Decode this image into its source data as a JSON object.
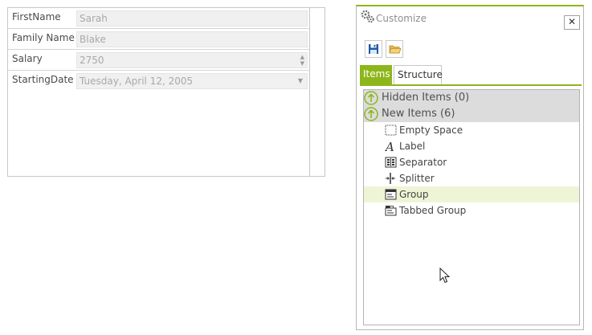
{
  "form": {
    "rows": [
      {
        "label": "FirstName",
        "value": "Sarah",
        "control": "text"
      },
      {
        "label": "Family Name",
        "value": "Blake",
        "control": "text"
      },
      {
        "label": "Salary",
        "value": "2750",
        "control": "spin"
      },
      {
        "label": "StartingDate",
        "value": "Tuesday, April 12, 2005",
        "control": "date"
      }
    ]
  },
  "customize": {
    "title": "Customize",
    "close_label": "✕",
    "toolbar": {
      "save_icon": "floppy-disk-icon",
      "open_icon": "open-folder-icon"
    },
    "tabs": [
      {
        "label": "Items",
        "active": true
      },
      {
        "label": "Structure",
        "active": false
      }
    ],
    "groups": [
      {
        "label": "Hidden Items (0)",
        "icon": "up-arrow-circle-icon"
      },
      {
        "label": "New Items (6)",
        "icon": "up-arrow-circle-icon"
      }
    ],
    "items": [
      {
        "label": "Empty Space",
        "icon": "empty-space-icon",
        "highlighted": false
      },
      {
        "label": "Label",
        "icon": "label-icon",
        "highlighted": false
      },
      {
        "label": "Separator",
        "icon": "separator-icon",
        "highlighted": false
      },
      {
        "label": "Splitter",
        "icon": "splitter-icon",
        "highlighted": false
      },
      {
        "label": "Group",
        "icon": "group-icon",
        "highlighted": true
      },
      {
        "label": "Tabbed Group",
        "icon": "tabbed-group-icon",
        "highlighted": false
      }
    ],
    "colors": {
      "accent": "#8db61b",
      "highlight": "#eef5d6",
      "group_bg": "#dcdcdc"
    }
  }
}
